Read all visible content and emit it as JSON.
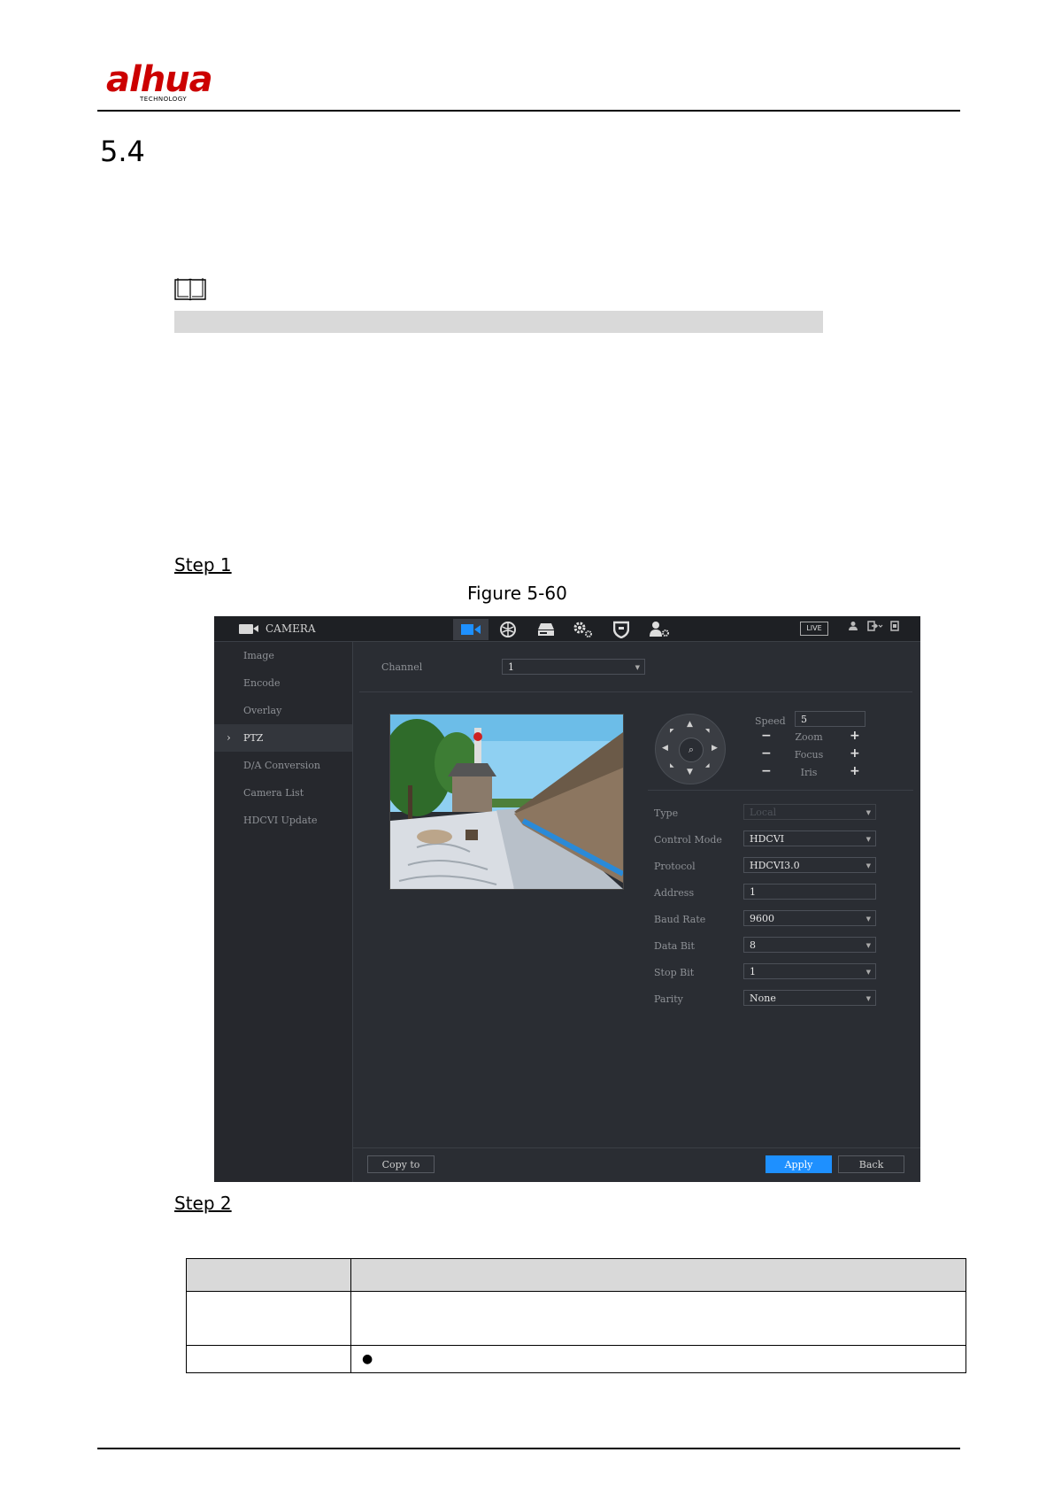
{
  "header": {
    "logo_text": "alhua",
    "logo_subtext": "TECHNOLOGY"
  },
  "section": {
    "number": "5.4"
  },
  "steps": {
    "step1": "Step 1",
    "step2": "Step 2"
  },
  "figure": {
    "caption": "Figure 5-60"
  },
  "screenshot": {
    "title": "CAMERA",
    "live_label": "LIVE",
    "top_icons": [
      "camera-icon",
      "network-icon",
      "storage-icon",
      "system-icon",
      "security-icon",
      "account-icon"
    ],
    "sidebar": {
      "items": [
        {
          "label": "Image"
        },
        {
          "label": "Encode"
        },
        {
          "label": "Overlay"
        },
        {
          "label": "PTZ"
        },
        {
          "label": "D/A Conversion"
        },
        {
          "label": "Camera List"
        },
        {
          "label": "HDCVI Update"
        }
      ],
      "active": "PTZ"
    },
    "channel": {
      "label": "Channel",
      "value": "1"
    },
    "ptz": {
      "speed_label": "Speed",
      "speed_value": "5",
      "zoom_label": "Zoom",
      "focus_label": "Focus",
      "iris_label": "Iris",
      "minus": "−",
      "plus": "+"
    },
    "form": {
      "type_label": "Type",
      "type_value": "Local",
      "control_mode_label": "Control Mode",
      "control_mode_value": "HDCVI",
      "protocol_label": "Protocol",
      "protocol_value": "HDCVI3.0",
      "address_label": "Address",
      "address_value": "1",
      "baud_rate_label": "Baud Rate",
      "baud_rate_value": "9600",
      "data_bit_label": "Data Bit",
      "data_bit_value": "8",
      "stop_bit_label": "Stop Bit",
      "stop_bit_value": "1",
      "parity_label": "Parity",
      "parity_value": "None"
    },
    "buttons": {
      "copy_to": "Copy to",
      "apply": "Apply",
      "back": "Back"
    },
    "colors": {
      "accent": "#1e90ff",
      "panel_bg": "#2a2d33",
      "sidebar_bg": "#26282d"
    }
  },
  "table": {
    "bullet": "●"
  }
}
